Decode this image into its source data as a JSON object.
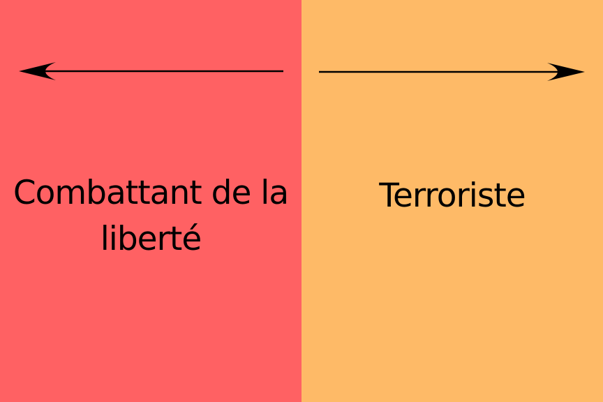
{
  "left_panel": {
    "label": "Combattant de la liberté",
    "color": "#FF6163"
  },
  "right_panel": {
    "label": "Terroriste",
    "color": "#FEBA67"
  },
  "arrows": {
    "left": "arrow-left",
    "right": "arrow-right",
    "color": "#000000"
  }
}
